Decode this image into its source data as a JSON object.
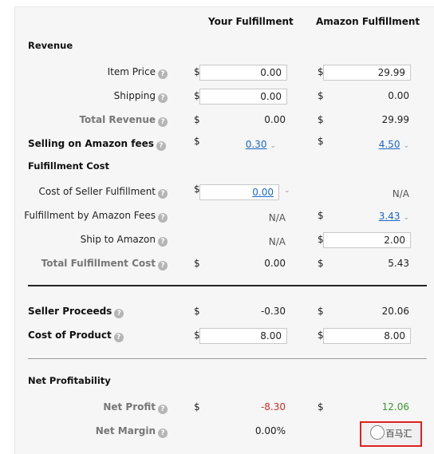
{
  "columns": {
    "yours": "Your Fulfillment",
    "amazon": "Amazon Fulfillment"
  },
  "currency": "$",
  "help_glyph": "?",
  "sections": {
    "revenue": "Revenue",
    "fulfillment_cost": "Fulfillment Cost",
    "net_profitability": "Net Profitability"
  },
  "rows": {
    "item_price": {
      "label": "Item Price",
      "yours": "0.00",
      "amazon": "29.99"
    },
    "shipping": {
      "label": "Shipping",
      "yours": "0.00",
      "amazon": "0.00"
    },
    "total_revenue": {
      "label": "Total Revenue",
      "yours": "0.00",
      "amazon": "29.99"
    },
    "selling_fees": {
      "label": "Selling on Amazon fees",
      "yours": "0.30",
      "amazon": "4.50"
    },
    "cost_seller_fulfillment": {
      "label": "Cost of Seller Fulfillment",
      "yours": "0.00",
      "amazon": "N/A"
    },
    "fba_fees": {
      "label": "Fulfillment by Amazon Fees",
      "yours": "N/A",
      "amazon": "3.43"
    },
    "ship_to_amazon": {
      "label": "Ship to Amazon",
      "yours": "N/A",
      "amazon": "2.00"
    },
    "total_fulfillment_cost": {
      "label": "Total Fulfillment Cost",
      "yours": "0.00",
      "amazon": "5.43"
    },
    "seller_proceeds": {
      "label": "Seller Proceeds",
      "yours": "-0.30",
      "amazon": "20.06"
    },
    "cost_of_product": {
      "label": "Cost of Product",
      "yours": "8.00",
      "amazon": "8.00"
    },
    "net_profit": {
      "label": "Net Profit",
      "yours": "-8.30",
      "amazon": "12.06"
    },
    "net_margin": {
      "label": "Net Margin",
      "yours": "0.00%"
    }
  },
  "watermark": {
    "text": "百马汇"
  },
  "colors": {
    "link": "#1a66c8",
    "negative": "#d12e1e",
    "positive": "#3a9a2a",
    "highlight_box": "#e02020"
  }
}
